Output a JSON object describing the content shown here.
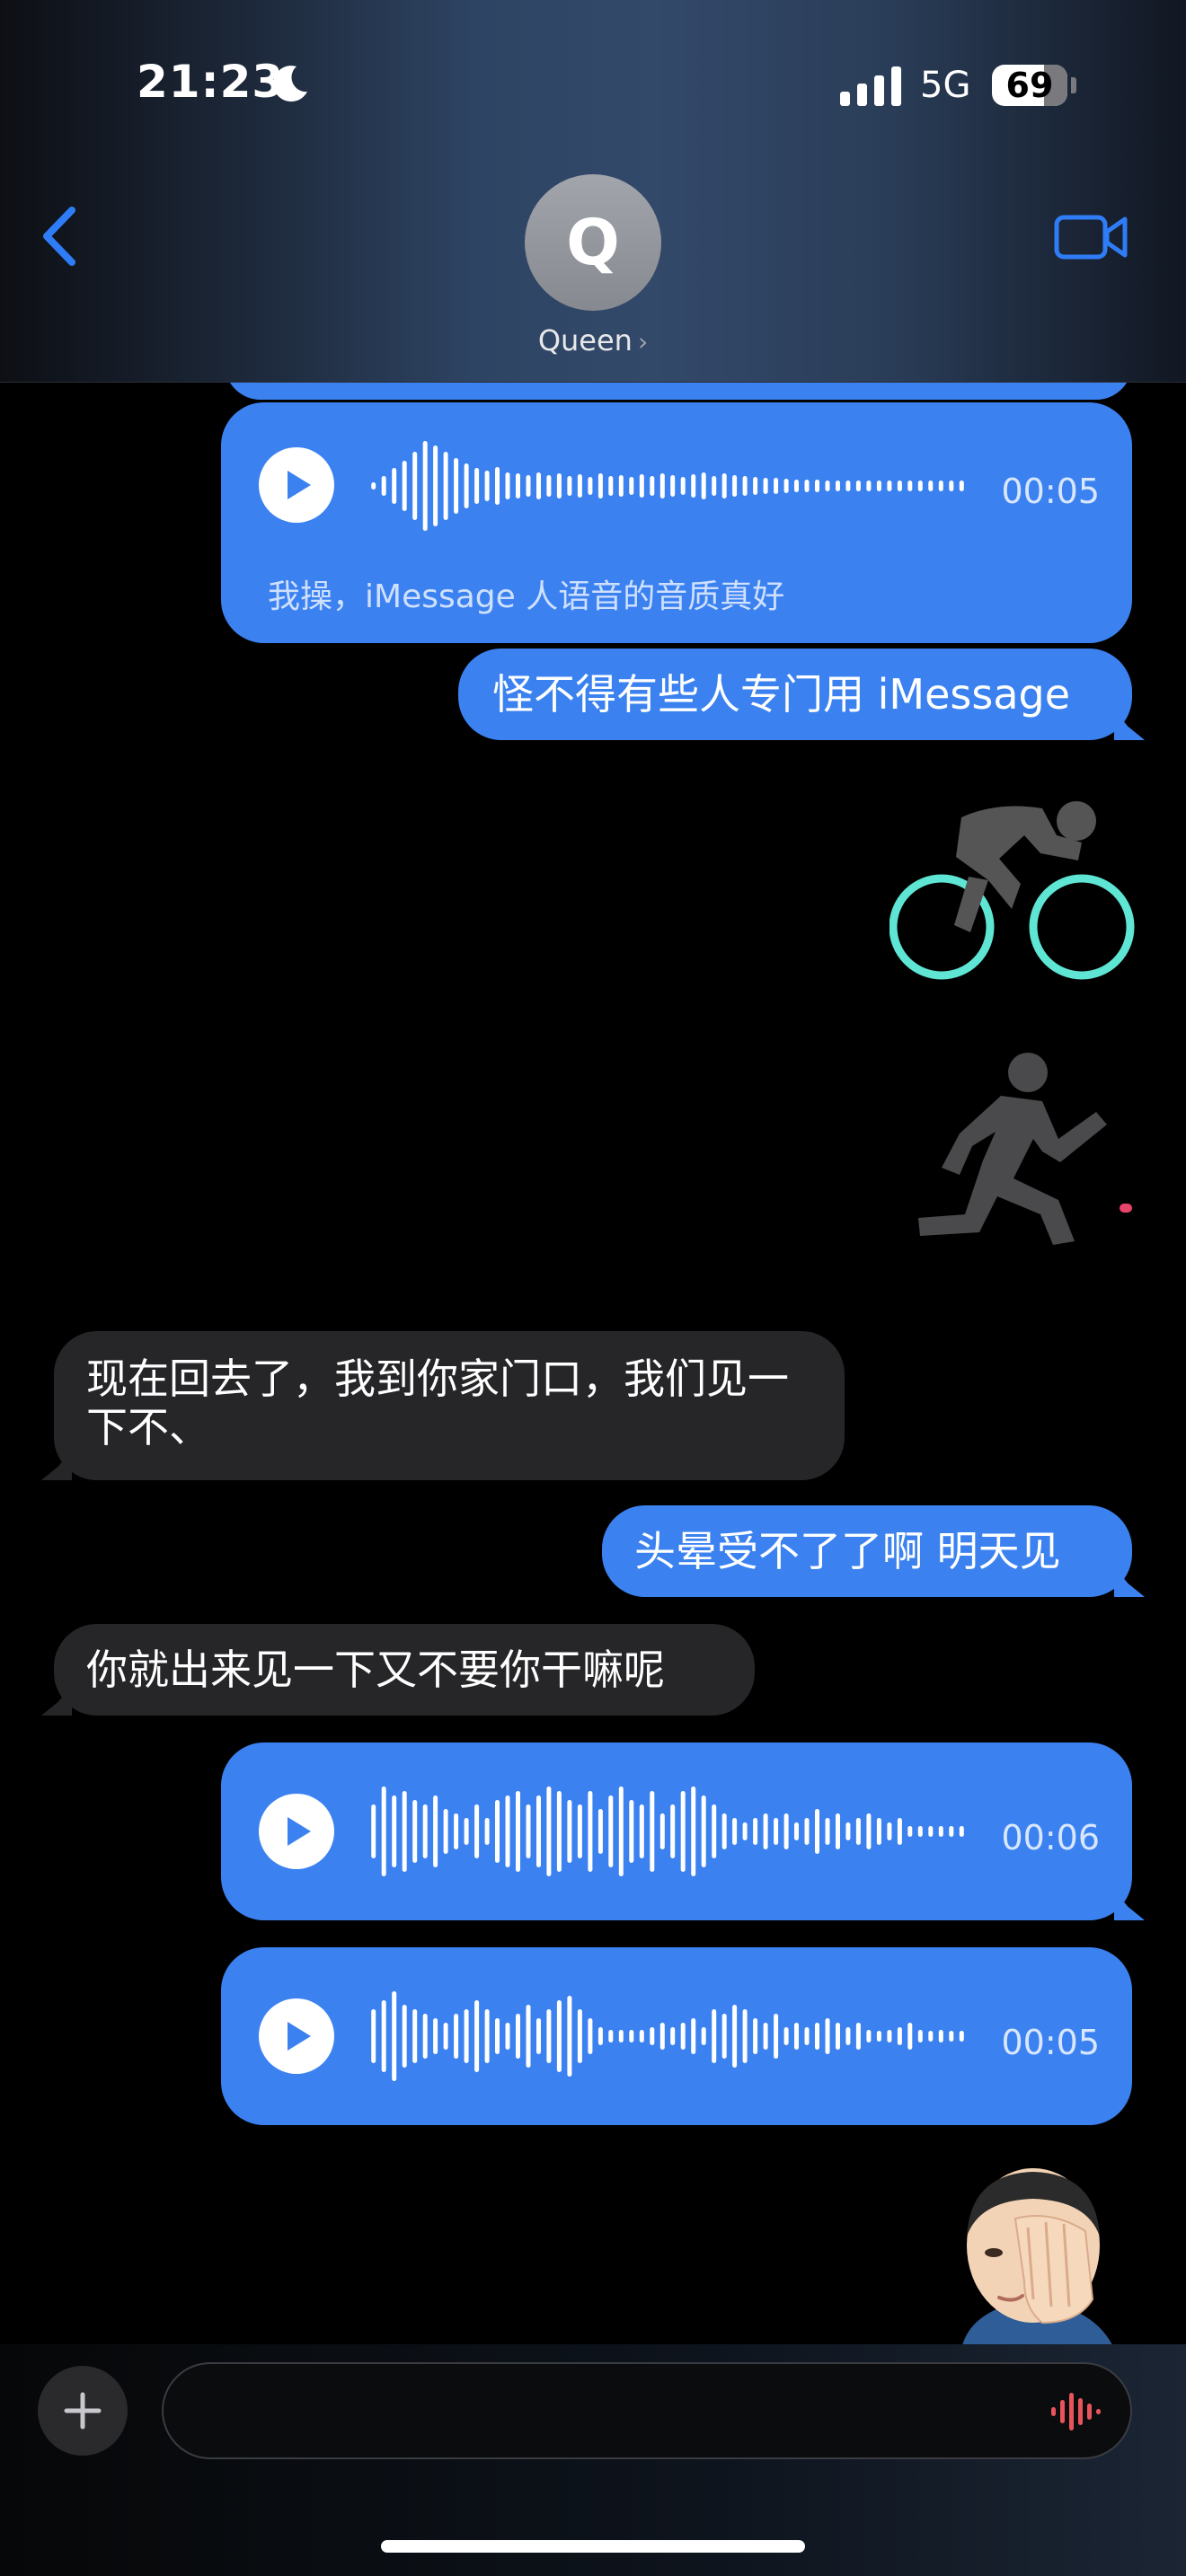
{
  "status_bar": {
    "time": "21:23",
    "network": "5G",
    "battery": "69"
  },
  "header": {
    "avatar_initial": "Q",
    "contact_name": "Queen",
    "chevron": "›"
  },
  "messages": [
    {
      "type": "voice",
      "from": "me",
      "duration": "00:05",
      "transcript": "我操，iMessage 人语音的音质真好"
    },
    {
      "type": "text",
      "from": "me",
      "text": "怪不得有些人专门用 iMessage"
    },
    {
      "type": "sticker",
      "from": "me",
      "icon": "cycling-icon"
    },
    {
      "type": "sticker",
      "from": "me",
      "icon": "running-icon"
    },
    {
      "type": "text",
      "from": "them",
      "text": "现在回去了，我到你家门口，我们见一下不、"
    },
    {
      "type": "text",
      "from": "me",
      "text": "头晕受不了了啊 明天见"
    },
    {
      "type": "text",
      "from": "them",
      "text": "你就出来见一下又不要你干嘛呢"
    },
    {
      "type": "voice",
      "from": "me",
      "duration": "00:06"
    },
    {
      "type": "voice",
      "from": "me",
      "duration": "00:05"
    },
    {
      "type": "sticker",
      "from": "me",
      "icon": "facepalm-memoji-icon"
    }
  ],
  "input": {
    "placeholder": ""
  },
  "colors": {
    "bubble_blue": "#3b82f0",
    "bubble_gray": "#262628",
    "accent_blue": "#2f7df6",
    "mic_red": "#e9545b",
    "cycling_wheels": "#5fe5d4"
  }
}
